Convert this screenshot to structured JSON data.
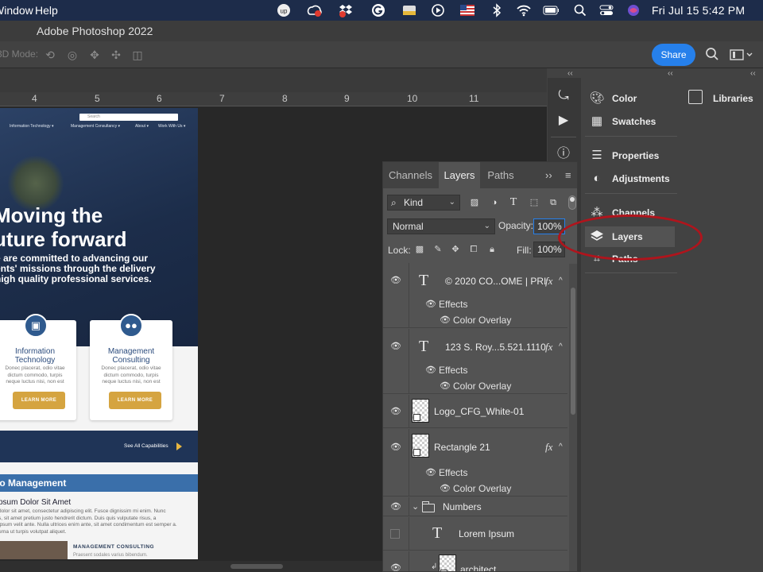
{
  "menubar": {
    "window_label": "Window",
    "help_label": "Help",
    "clock": "Fri Jul 15  5:42 PM"
  },
  "app": {
    "title": "Adobe Photoshop 2022",
    "mode_label": "3D Mode:",
    "share_label": "Share"
  },
  "ruler": {
    "labels": [
      "4",
      "5",
      "6",
      "7",
      "8",
      "9",
      "10",
      "11"
    ]
  },
  "webpage": {
    "search_placeholder": "Search",
    "nav": [
      "Information Technology ▾",
      "Management Consultancy ▾",
      "About ▾",
      "Work With Us ▾"
    ],
    "hero_line1": "Moving the",
    "hero_line2": "uture forward",
    "sub_line1": "e are committed to advancing our",
    "sub_line2": "ents' missions through the delivery",
    "sub_line3": "high quality professional services.",
    "cards": [
      {
        "title1": "Information",
        "title2": "Technology",
        "body1": "Donec placerat, odio vitae",
        "body2": "dictum commodo, turpis",
        "body3": "neque luctus nisi, non  est",
        "button": "LEARN MORE"
      },
      {
        "title1": "Management",
        "title2": "Consulting",
        "body1": "Donec placerat, odio vitae",
        "body2": "dictum commodo, turpis",
        "body3": "neque luctus nisi, non  est",
        "button": "LEARN MORE"
      }
    ],
    "see_all": "See All Capabilities",
    "portfolio_heading": "io Management",
    "lorem_heading": "psum Dolor Sit Amet",
    "lorem_p1": "dolor sit amet, consectetur adipiscing elit. Fusce dignissim mi enim. Nunc",
    "lorem_p2": "s, sit amet pretium justo hendrerit dictum. Duis quis vulputate risus, a",
    "lorem_p3": "ipsum velit ante. Nulla ultrices enim ante, sit amet condimentum est semper a.",
    "lorem_p4": "urna ut turpis volutpat aliquet.",
    "mc_title": "MANAGEMENT CONSULTING",
    "mc_body": "Praesent sodales varius bibendum."
  },
  "layers_panel": {
    "tabs": [
      "Channels",
      "Layers",
      "Paths"
    ],
    "active_tab": "Layers",
    "kind_label": "Kind",
    "blend_mode": "Normal",
    "opacity_label": "Opacity:",
    "opacity_value": "100%",
    "lock_label": "Lock:",
    "fill_label": "Fill:",
    "fill_value": "100%",
    "layers": [
      {
        "name": "© 2020 CO...OME | PRI",
        "type": "text",
        "fx": "fx",
        "effects_label": "Effects",
        "effect": "Color Overlay"
      },
      {
        "name": "123 S. Roy...5.521.1110",
        "type": "text",
        "fx": "fx",
        "effects_label": "Effects",
        "effect": "Color Overlay"
      },
      {
        "name": "Logo_CFG_White-01",
        "type": "smart"
      },
      {
        "name": "Rectangle 21",
        "type": "shape",
        "fx": "fx",
        "effects_label": "Effects",
        "effect": "Color Overlay"
      },
      {
        "name": "Numbers",
        "type": "group"
      },
      {
        "name": "Lorem Ipsum",
        "type": "text",
        "hidden": true
      },
      {
        "name": "architect",
        "type": "smart"
      }
    ]
  },
  "dock": {
    "col2": [
      "Color",
      "Swatches",
      "Properties",
      "Adjustments",
      "Channels",
      "Layers",
      "Paths"
    ],
    "col3": [
      "Libraries"
    ],
    "selected": "Layers",
    "highlight_color": "#b0141c"
  }
}
